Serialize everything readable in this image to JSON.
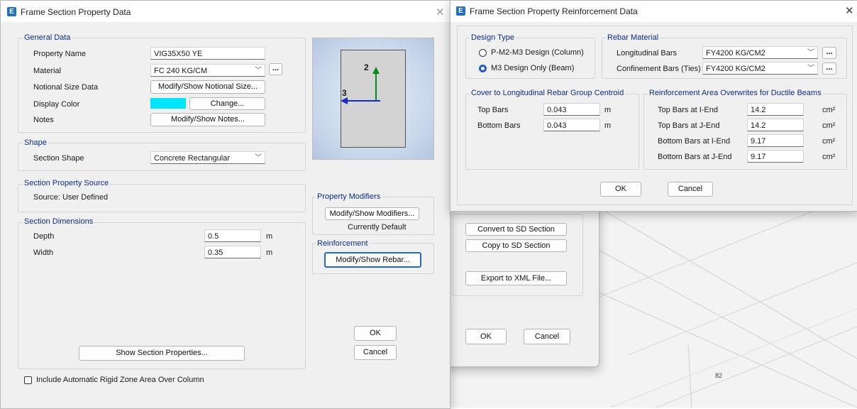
{
  "canvas": {
    "label": "82"
  },
  "dialog_main": {
    "title": "Frame Section Property Data",
    "general_data": {
      "legend": "General Data",
      "property_name_label": "Property Name",
      "property_name_value": "VIG35X50 YE",
      "material_label": "Material",
      "material_value": "FC 240 KG/CM",
      "notional_label": "Notional Size Data",
      "notional_button": "Modify/Show Notional Size...",
      "display_color_label": "Display Color",
      "display_color_value": "#00e5ff",
      "change_button": "Change...",
      "notes_label": "Notes",
      "notes_button": "Modify/Show Notes..."
    },
    "shape": {
      "legend": "Shape",
      "section_shape_label": "Section Shape",
      "section_shape_value": "Concrete Rectangular"
    },
    "source": {
      "legend": "Section Property Source",
      "text": "Source:  User Defined"
    },
    "dimensions": {
      "legend": "Section Dimensions",
      "depth_label": "Depth",
      "depth_value": "0.5",
      "depth_unit": "m",
      "width_label": "Width",
      "width_value": "0.35",
      "width_unit": "m"
    },
    "preview": {
      "axis2": "2",
      "axis3": "3"
    },
    "property_modifiers": {
      "legend": "Property Modifiers",
      "button": "Modify/Show Modifiers...",
      "status": "Currently Default"
    },
    "reinforcement": {
      "legend": "Reinforcement",
      "button": "Modify/Show Rebar..."
    },
    "show_properties_button": "Show Section Properties...",
    "ok": "OK",
    "cancel": "Cancel",
    "rigid_zone_label": "Include Automatic Rigid Zone Area Over Column"
  },
  "dialog_back": {
    "convert_button": "Convert to SD Section",
    "copy_button": "Copy to SD Section",
    "export_button": "Export to XML File...",
    "ok": "OK",
    "cancel": "Cancel"
  },
  "dialog_rebar": {
    "title": "Frame Section Property Reinforcement Data",
    "design_type": {
      "legend": "Design Type",
      "option_column": "P-M2-M3 Design  (Column)",
      "option_beam": "M3 Design Only  (Beam)",
      "selected": "beam"
    },
    "rebar_material": {
      "legend": "Rebar Material",
      "longitudinal_label": "Longitudinal Bars",
      "longitudinal_value": "FY4200 KG/CM2",
      "confinement_label": "Confinement Bars (Ties)",
      "confinement_value": "FY4200 KG/CM2"
    },
    "cover": {
      "legend": "Cover to Longitudinal Rebar Group Centroid",
      "top_label": "Top Bars",
      "top_value": "0.043",
      "bottom_label": "Bottom  Bars",
      "bottom_value": "0.043",
      "unit": "m"
    },
    "overwrites": {
      "legend": "Reinforcement Area Overwrites for Ductile Beams",
      "unit": "cm²",
      "rows": [
        {
          "label": "Top Bars at I-End",
          "value": "14.2"
        },
        {
          "label": "Top Bars at J-End",
          "value": "14.2"
        },
        {
          "label": "Bottom Bars at I-End",
          "value": "9.17"
        },
        {
          "label": "Bottom Bars at J-End",
          "value": "9.17"
        }
      ]
    },
    "ok": "OK",
    "cancel": "Cancel"
  }
}
